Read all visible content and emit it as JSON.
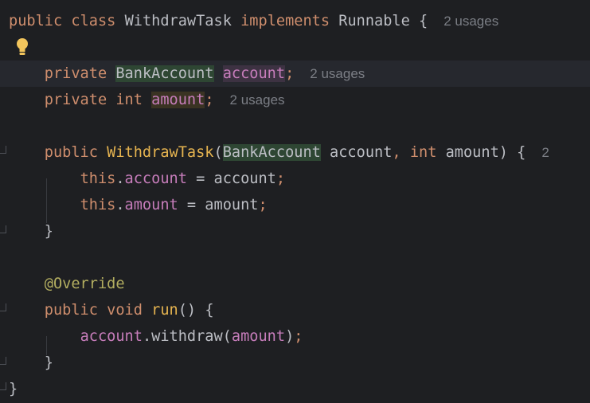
{
  "editor": {
    "lines": [
      {
        "tokens": [
          {
            "t": "public",
            "c": "kw"
          },
          {
            "t": " ",
            "c": "plain"
          },
          {
            "t": "class",
            "c": "kw"
          },
          {
            "t": " ",
            "c": "plain"
          },
          {
            "t": "WithdrawTask",
            "c": "cls"
          },
          {
            "t": " ",
            "c": "plain"
          },
          {
            "t": "implements",
            "c": "kw"
          },
          {
            "t": " ",
            "c": "plain"
          },
          {
            "t": "Runnable",
            "c": "cls"
          },
          {
            "t": " {",
            "c": "punct"
          }
        ],
        "hint": "2 usages"
      },
      {
        "tokens": []
      },
      {
        "tokens": [
          {
            "t": "    ",
            "c": "plain"
          },
          {
            "t": "private",
            "c": "kw"
          },
          {
            "t": " ",
            "c": "plain"
          },
          {
            "t": "BankAccount",
            "c": "cls hl-green"
          },
          {
            "t": " ",
            "c": "plain"
          },
          {
            "t": "account",
            "c": "fld hl-purple"
          },
          {
            "t": ";",
            "c": "semi"
          }
        ],
        "hint": "2 usages",
        "current": true
      },
      {
        "tokens": [
          {
            "t": "    ",
            "c": "plain"
          },
          {
            "t": "private",
            "c": "kw"
          },
          {
            "t": " ",
            "c": "plain"
          },
          {
            "t": "int",
            "c": "kw"
          },
          {
            "t": " ",
            "c": "plain"
          },
          {
            "t": "amount",
            "c": "fld hl-brown"
          },
          {
            "t": ";",
            "c": "semi"
          }
        ],
        "hint": "2 usages"
      },
      {
        "tokens": []
      },
      {
        "tokens": [
          {
            "t": "    ",
            "c": "plain"
          },
          {
            "t": "public",
            "c": "kw"
          },
          {
            "t": " ",
            "c": "plain"
          },
          {
            "t": "WithdrawTask",
            "c": "decl"
          },
          {
            "t": "(",
            "c": "punct"
          },
          {
            "t": "BankAccount",
            "c": "cls hl-green"
          },
          {
            "t": " account",
            "c": "plain"
          },
          {
            "t": ",",
            "c": "semi"
          },
          {
            "t": " ",
            "c": "plain"
          },
          {
            "t": "int",
            "c": "kw"
          },
          {
            "t": " amount) {",
            "c": "plain"
          }
        ],
        "hint": "2"
      },
      {
        "tokens": [
          {
            "t": "        ",
            "c": "plain"
          },
          {
            "t": "this",
            "c": "kw"
          },
          {
            "t": ".",
            "c": "plain"
          },
          {
            "t": "account",
            "c": "fld"
          },
          {
            "t": " = account",
            "c": "plain"
          },
          {
            "t": ";",
            "c": "semi"
          }
        ]
      },
      {
        "tokens": [
          {
            "t": "        ",
            "c": "plain"
          },
          {
            "t": "this",
            "c": "kw"
          },
          {
            "t": ".",
            "c": "plain"
          },
          {
            "t": "amount",
            "c": "fld"
          },
          {
            "t": " = amount",
            "c": "plain"
          },
          {
            "t": ";",
            "c": "semi"
          }
        ]
      },
      {
        "tokens": [
          {
            "t": "    ",
            "c": "plain"
          },
          {
            "t": "}",
            "c": "punct"
          }
        ]
      },
      {
        "tokens": []
      },
      {
        "tokens": [
          {
            "t": "    ",
            "c": "plain"
          },
          {
            "t": "@Override",
            "c": "ann"
          }
        ]
      },
      {
        "tokens": [
          {
            "t": "    ",
            "c": "plain"
          },
          {
            "t": "public",
            "c": "kw"
          },
          {
            "t": " ",
            "c": "plain"
          },
          {
            "t": "void",
            "c": "kw"
          },
          {
            "t": " ",
            "c": "plain"
          },
          {
            "t": "run",
            "c": "decl"
          },
          {
            "t": "() {",
            "c": "punct"
          }
        ]
      },
      {
        "tokens": [
          {
            "t": "        ",
            "c": "plain"
          },
          {
            "t": "account",
            "c": "fld"
          },
          {
            "t": ".withdraw(",
            "c": "plain"
          },
          {
            "t": "amount",
            "c": "fld"
          },
          {
            "t": ")",
            "c": "plain"
          },
          {
            "t": ";",
            "c": "semi"
          }
        ]
      },
      {
        "tokens": [
          {
            "t": "    ",
            "c": "plain"
          },
          {
            "t": "}",
            "c": "punct"
          }
        ]
      },
      {
        "tokens": [
          {
            "t": "}",
            "c": "punct"
          }
        ]
      }
    ],
    "gutter_icon": "lightbulb-icon",
    "colors": {
      "background": "#1e1f22",
      "keyword": "#cf8e6d",
      "field": "#c77dbb",
      "declaration": "#e6b450",
      "annotation": "#b3ae60",
      "text": "#bcbec4",
      "hint": "#7b7e85"
    }
  }
}
